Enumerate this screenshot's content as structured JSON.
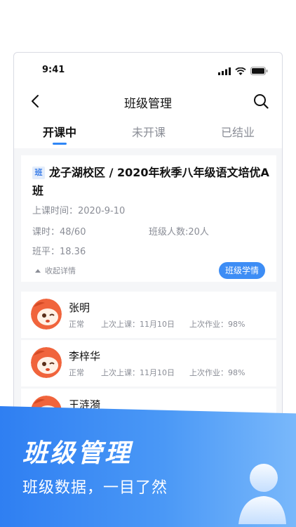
{
  "status_bar": {
    "time": "9:41"
  },
  "nav": {
    "title": "班级管理"
  },
  "tabs": [
    {
      "label": "开课中",
      "active": true
    },
    {
      "label": "未开课",
      "active": false
    },
    {
      "label": "已结业",
      "active": false
    }
  ],
  "class_card": {
    "badge": "班",
    "title": "龙子湖校区 / 2020年秋季八年级语文培优A班",
    "start_time": "上课时间：2020-9-10",
    "hours": "课时：48/60",
    "student_count": "班级人数:20人",
    "average": "班平：18.36",
    "collapse_label": "收起详情",
    "detail_button": "班级学情"
  },
  "students": [
    {
      "name": "张明",
      "status": "正常",
      "last_class": "上次上课：11月10日",
      "last_homework": "上次作业：98%"
    },
    {
      "name": "李梓华",
      "status": "正常",
      "last_class": "上次上课：11月10日",
      "last_homework": "上次作业：98%"
    },
    {
      "name": "王涟漪",
      "status": "",
      "last_class": "",
      "last_homework": ""
    }
  ],
  "banner": {
    "title": "班级管理",
    "subtitle": "班级数据，一目了然"
  },
  "icons": {
    "back": "chevron-left-icon",
    "search": "search-icon",
    "signal": "signal-icon",
    "wifi": "wifi-icon",
    "battery": "battery-icon",
    "avatar": "fox-mascot-avatar",
    "user": "user-icon"
  },
  "colors": {
    "accent": "#2f86f6",
    "banner_start": "#2f7ff2",
    "banner_end": "#79b8fb",
    "avatar_orange": "#f0643c"
  }
}
